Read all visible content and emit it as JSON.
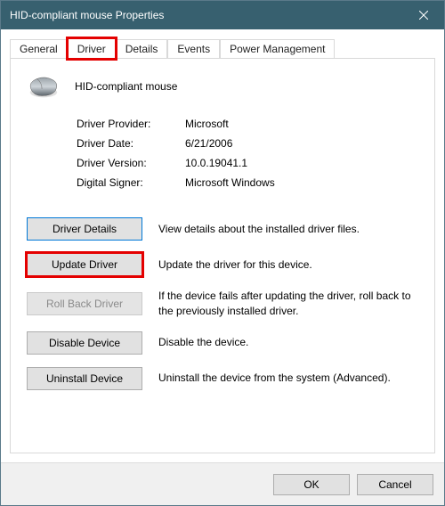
{
  "window": {
    "title": "HID-compliant mouse Properties"
  },
  "tabs": {
    "general": "General",
    "driver": "Driver",
    "details": "Details",
    "events": "Events",
    "power": "Power Management"
  },
  "device": {
    "name": "HID-compliant mouse"
  },
  "info": {
    "provider_label": "Driver Provider:",
    "provider_value": "Microsoft",
    "date_label": "Driver Date:",
    "date_value": "6/21/2006",
    "version_label": "Driver Version:",
    "version_value": "10.0.19041.1",
    "signer_label": "Digital Signer:",
    "signer_value": "Microsoft Windows"
  },
  "actions": {
    "details": {
      "label": "Driver Details",
      "desc": "View details about the installed driver files."
    },
    "update": {
      "label": "Update Driver",
      "desc": "Update the driver for this device."
    },
    "rollback": {
      "label": "Roll Back Driver",
      "desc": "If the device fails after updating the driver, roll back to the previously installed driver."
    },
    "disable": {
      "label": "Disable Device",
      "desc": "Disable the device."
    },
    "uninstall": {
      "label": "Uninstall Device",
      "desc": "Uninstall the device from the system (Advanced)."
    }
  },
  "footer": {
    "ok": "OK",
    "cancel": "Cancel"
  }
}
